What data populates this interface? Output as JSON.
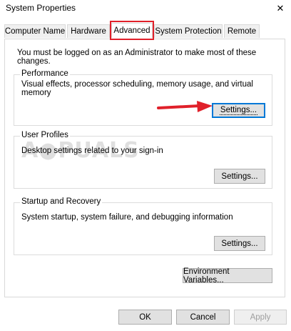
{
  "window": {
    "title": "System Properties",
    "close_glyph": "✕"
  },
  "tabs": [
    {
      "label": "Computer Name"
    },
    {
      "label": "Hardware"
    },
    {
      "label": "Advanced"
    },
    {
      "label": "System Protection"
    },
    {
      "label": "Remote"
    }
  ],
  "active_tab": "Advanced",
  "advanced": {
    "admin_note": "You must be logged on as an Administrator to make most of these changes.",
    "performance": {
      "title": "Performance",
      "description": "Visual effects, processor scheduling, memory usage, and virtual memory",
      "button": "Settings..."
    },
    "user_profiles": {
      "title": "User Profiles",
      "description": "Desktop settings related to your sign-in",
      "button": "Settings..."
    },
    "startup_recovery": {
      "title": "Startup and Recovery",
      "description": "System startup, system failure, and debugging information",
      "button": "Settings..."
    },
    "env_button": "Environment Variables..."
  },
  "footer": {
    "ok": "OK",
    "cancel": "Cancel",
    "apply": "Apply"
  },
  "colors": {
    "annotation_red": "#e0202a",
    "focus_blue": "#0078d7"
  }
}
